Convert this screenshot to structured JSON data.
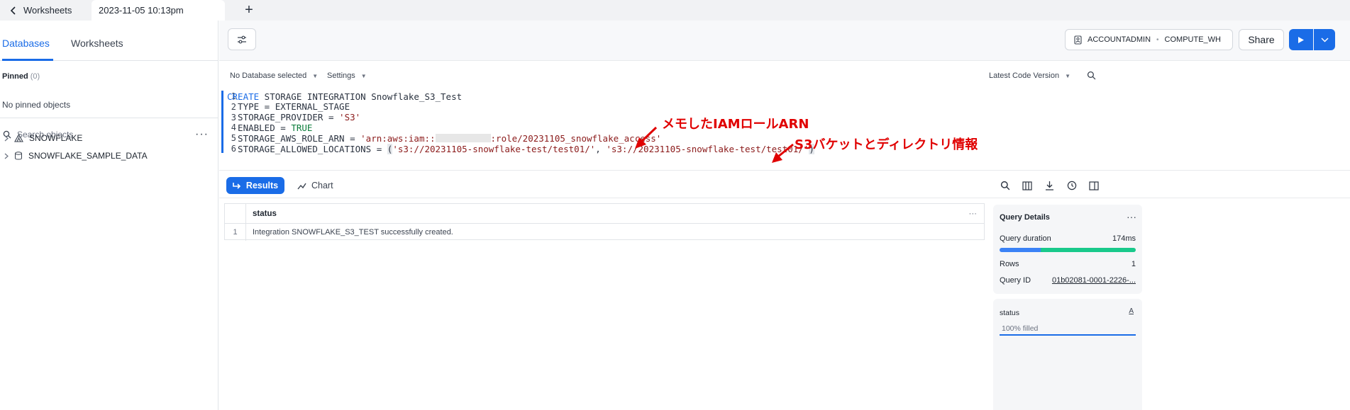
{
  "topbar": {
    "back_label": "Worksheets",
    "active_tab": "2023-11-05 10:13pm",
    "add_tab": "+"
  },
  "sidebar": {
    "tabs": [
      {
        "label": "Databases",
        "active": true
      },
      {
        "label": "Worksheets",
        "active": false
      }
    ],
    "pinned_label": "Pinned",
    "pinned_count": "(0)",
    "pinned_empty": "No pinned objects",
    "search_placeholder": "Search objects",
    "databases": [
      {
        "name": "SNOWFLAKE",
        "icon": "share-icon"
      },
      {
        "name": "SNOWFLAKE_SAMPLE_DATA",
        "icon": "database-icon"
      }
    ]
  },
  "toolbar": {
    "role": "ACCOUNTADMIN",
    "warehouse": "COMPUTE_WH",
    "share_label": "Share"
  },
  "editor": {
    "database_select": "No Database selected",
    "settings_label": "Settings",
    "version_select": "Latest Code Version",
    "lines": [
      {
        "n": "1",
        "parts": [
          {
            "t": "CREATE",
            "c": "kw"
          },
          {
            "t": " STORAGE INTEGRATION Snowflake_S3_Test",
            "c": ""
          }
        ]
      },
      {
        "n": "2",
        "parts": [
          {
            "t": "  TYPE = EXTERNAL_STAGE",
            "c": ""
          }
        ]
      },
      {
        "n": "3",
        "parts": [
          {
            "t": "  STORAGE_PROVIDER = ",
            "c": ""
          },
          {
            "t": "'S3'",
            "c": "str"
          }
        ]
      },
      {
        "n": "4",
        "parts": [
          {
            "t": "  ENABLED = ",
            "c": ""
          },
          {
            "t": "TRUE",
            "c": "bool"
          }
        ]
      },
      {
        "n": "5",
        "parts": [
          {
            "t": "  STORAGE_AWS_ROLE_ARN = ",
            "c": ""
          },
          {
            "t": "'arn:aws:iam::",
            "c": "str"
          },
          {
            "t": "",
            "c": "blur"
          },
          {
            "t": ":role/20231105_snowflake_access'",
            "c": "str"
          }
        ]
      },
      {
        "n": "6",
        "parts": [
          {
            "t": "  STORAGE_ALLOWED_LOCATIONS = ",
            "c": ""
          },
          {
            "t": "(",
            "c": "brk"
          },
          {
            "t": "'s3://20231105-snowflake-test/test01/'",
            "c": "str"
          },
          {
            "t": ", ",
            "c": ""
          },
          {
            "t": "'s3://20231105-snowflake-test/test01/'",
            "c": "str"
          },
          {
            "t": ")",
            "c": "brk"
          }
        ]
      }
    ]
  },
  "annotations": {
    "iam_note": "メモしたIAMロールARN",
    "s3_note": "S3バケットとディレクトリ情報",
    "color": "#e00000"
  },
  "results": {
    "results_tab": "Results",
    "chart_tab": "Chart",
    "column_header": "status",
    "rows": [
      {
        "idx": "1",
        "status": "Integration SNOWFLAKE_S3_TEST successfully created."
      }
    ]
  },
  "query_details": {
    "title": "Query Details",
    "duration_label": "Query duration",
    "duration_value": "174ms",
    "duration_split": [
      0.3,
      0.7
    ],
    "rows_label": "Rows",
    "rows_value": "1",
    "query_id_label": "Query ID",
    "query_id_value": "01b02081-0001-2226-..."
  },
  "status_panel": {
    "title": "status",
    "type_icon": "A",
    "filled": "100% filled"
  },
  "colors": {
    "accent": "#1a6ce7",
    "duration_exec": "#3b82f6",
    "duration_other": "#19c98b"
  }
}
